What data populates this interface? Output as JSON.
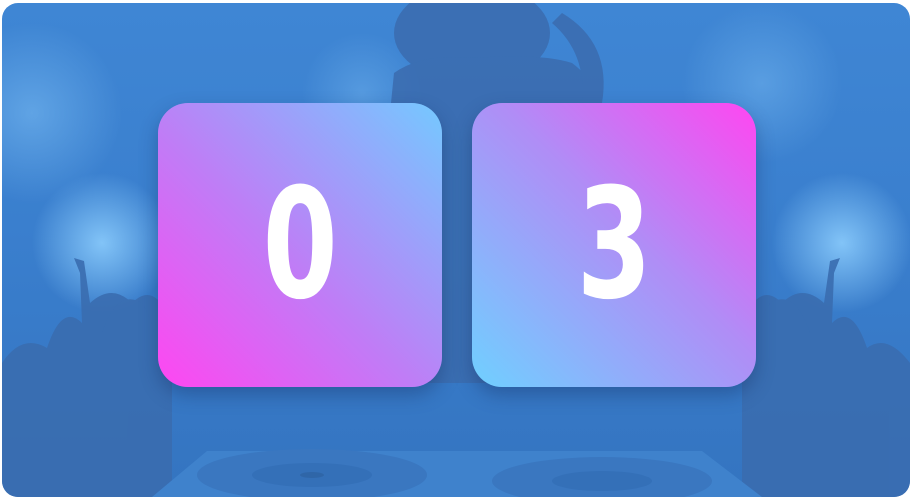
{
  "counter": {
    "digits": [
      {
        "value": "0"
      },
      {
        "value": "3"
      }
    ]
  },
  "colors": {
    "background": "#3f86d4",
    "tile_pink": "#ff46f1",
    "tile_cyan": "#6fd0ff",
    "digit": "#ffffff"
  },
  "icons": [
    "dj-silhouette",
    "crowd-silhouette",
    "turntable-icon",
    "spotlight-glow"
  ]
}
